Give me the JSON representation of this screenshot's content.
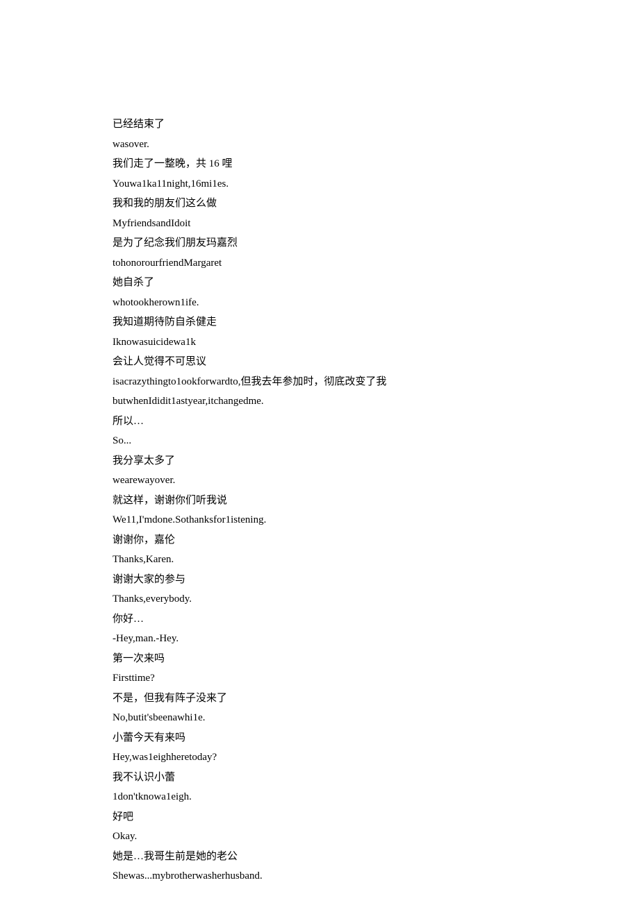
{
  "lines": [
    "已经结束了",
    "wasover.",
    "我们走了一整晚，共 16 哩",
    "Youwa1ka11night,16mi1es.",
    "我和我的朋友们这么做",
    "MyfriendsandIdoit",
    "是为了纪念我们朋友玛嘉烈",
    "tohonorourfriendMargaret",
    "她自杀了",
    "whotookherown1ife.",
    "我知道期待防自杀健走",
    "Iknowasuicidewa1k",
    "会让人觉得不可思议",
    "isacrazythingto1ookforwardto,但我去年参加时，彻底改变了我",
    "butwhenIdidit1astyear,itchangedme.",
    "所以…",
    "So...",
    "我分享太多了",
    "wearewayover.",
    "就这样，谢谢你们听我说",
    "We11,I'mdone.Sothanksfor1istening.",
    "谢谢你，嘉伦",
    "Thanks,Karen.",
    "谢谢大家的参与",
    "Thanks,everybody.",
    "你好…",
    "-Hey,man.-Hey.",
    "第一次来吗",
    "Firsttime?",
    "不是，但我有阵子没来了",
    "No,butit'sbeenawhi1e.",
    "小蕾今天有来吗",
    "Hey,was1eighheretoday?",
    "我不认识小蕾",
    "1don'tknowa1eigh.",
    "好吧",
    "Okay.",
    "她是…我哥生前是她的老公",
    "Shewas...mybrotherwasherhusband."
  ]
}
